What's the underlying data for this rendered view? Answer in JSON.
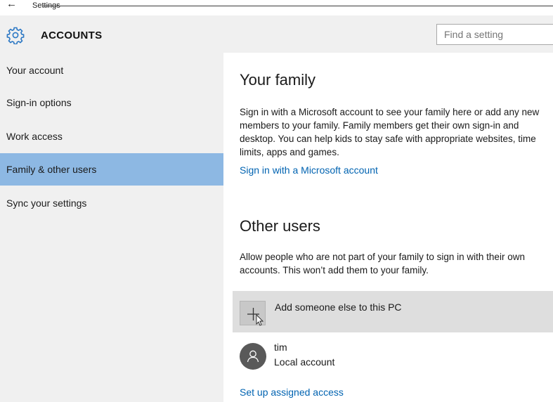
{
  "window": {
    "title": "Settings",
    "back_glyph": "←"
  },
  "header": {
    "icon": "gear-icon",
    "heading": "ACCOUNTS",
    "search_placeholder": "Find a setting"
  },
  "sidebar": {
    "selected_index": 3,
    "items": [
      {
        "label": "Your account"
      },
      {
        "label": "Sign-in options"
      },
      {
        "label": "Work access"
      },
      {
        "label": "Family & other users"
      },
      {
        "label": "Sync your settings"
      }
    ]
  },
  "family": {
    "title": "Your family",
    "description": "Sign in with a Microsoft account to see your family here or add any new members to your family. Family members get their own sign-in and desktop. You can help kids to stay safe with appropriate websites, time limits, apps and games.",
    "link": "Sign in with a Microsoft account"
  },
  "other_users": {
    "title": "Other users",
    "description": "Allow people who are not part of your family to sign in with their own accounts. This won’t add them to your family.",
    "add_label": "Add someone else to this PC",
    "add_icon": "plus-icon",
    "users": [
      {
        "name": "tim",
        "account_type": "Local account",
        "icon": "person-icon"
      }
    ],
    "assigned_access_link": "Set up assigned access"
  },
  "colors": {
    "accent": "#0063b1",
    "selection": "#8db8e3",
    "sidebar_bg": "#f0f0f0",
    "hover_bg": "#dedede"
  }
}
